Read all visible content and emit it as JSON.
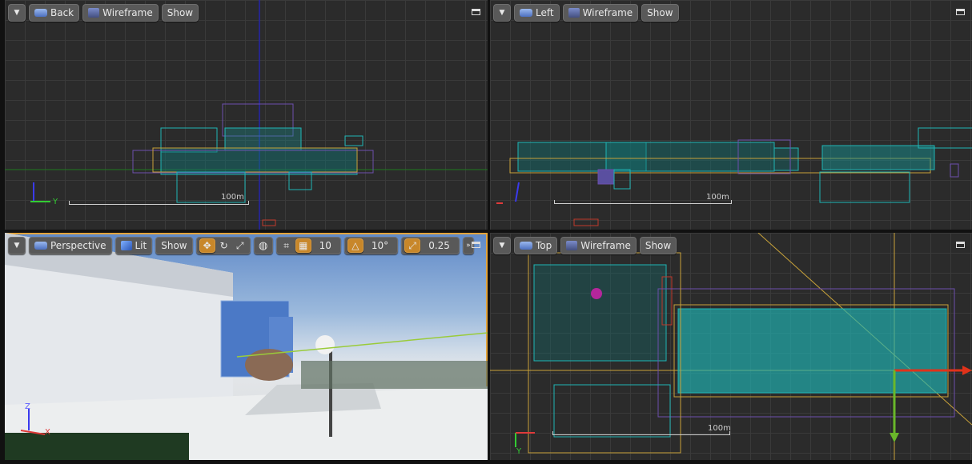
{
  "viewports": {
    "back": {
      "view_label": "Back",
      "mode_label": "Wireframe",
      "show_label": "Show",
      "scale_label": "100m",
      "axis_y": "Y"
    },
    "left": {
      "view_label": "Left",
      "mode_label": "Wireframe",
      "show_label": "Show",
      "scale_label": "100m"
    },
    "perspective": {
      "view_label": "Perspective",
      "mode_label": "Lit",
      "show_label": "Show",
      "grid_snap_value": "10",
      "rotation_snap_value": "10°",
      "scale_snap_value": "0.25",
      "axis_z": "Z",
      "axis_x": "X"
    },
    "top": {
      "view_label": "Top",
      "mode_label": "Wireframe",
      "show_label": "Show",
      "scale_label": "100m",
      "axis_y": "Y"
    }
  },
  "colors": {
    "active_border": "#e3a43b",
    "wireframe": "#1fb5b5",
    "toggle_on": "#c8872a"
  }
}
